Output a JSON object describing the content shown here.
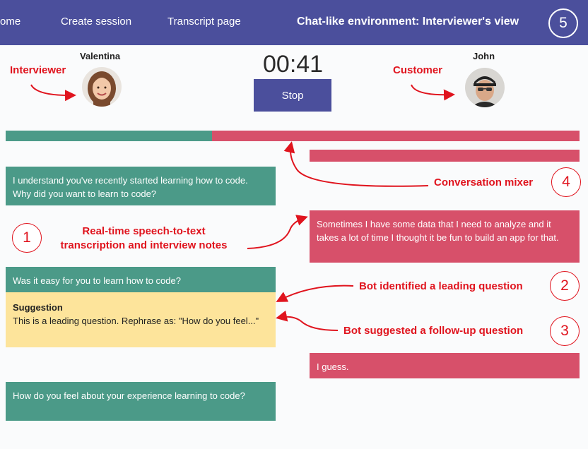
{
  "nav": {
    "home_label": "ome",
    "create_label": "Create session",
    "transcript_label": "Transcript page",
    "title": "Chat-like environment: Interviewer's view",
    "step_number": "5"
  },
  "participants": {
    "interviewer_name": "Valentina",
    "customer_name": "John"
  },
  "timer": "00:41",
  "stop_label": "Stop",
  "mixer": {
    "interviewer_share": 0.36,
    "customer_share": 0.64
  },
  "messages": [
    {
      "speaker": "interviewer",
      "text": "I understand you've recently started learning how to code. Why did you want to learn to code?"
    },
    {
      "speaker": "customer",
      "text": "Sometimes I have some data that I need to analyze and it takes a lot of time I thought it be fun to build an app for that."
    },
    {
      "speaker": "interviewer",
      "text": "Was it easy for you to learn how to code?"
    },
    {
      "speaker": "customer",
      "text": "I guess."
    },
    {
      "speaker": "interviewer",
      "text": "How  do you feel about your experience learning to code?"
    }
  ],
  "suggestion": {
    "title": "Suggestion",
    "text": "This is a leading question. Rephrase as: \"How do you feel...\""
  },
  "annotations": {
    "interviewer": "Interviewer",
    "customer": "Customer",
    "mixer": "Conversation mixer",
    "mixer_num": "4",
    "transcription_line1": "Real-time speech-to-text",
    "transcription_line2": "transcription and interview notes",
    "transcription_num": "1",
    "leading": "Bot identified a leading question",
    "leading_num": "2",
    "followup": "Bot suggested a follow-up question",
    "followup_num": "3"
  },
  "colors": {
    "nav": "#4b4f9c",
    "interviewer": "#4b9a88",
    "customer": "#d7506a",
    "suggestion": "#fde49b",
    "annotation": "#e0141e"
  }
}
